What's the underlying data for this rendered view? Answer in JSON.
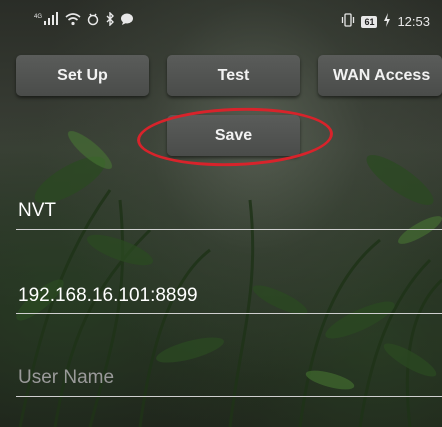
{
  "status_bar": {
    "network_label": "4G",
    "time": "12:53",
    "battery": "61",
    "icons": [
      "signal-icon",
      "wifi-icon",
      "nfc-icon",
      "bluetooth-icon",
      "chat-icon",
      "vibrate-icon",
      "battery-icon",
      "charging-icon"
    ]
  },
  "toolbar": {
    "setup_label": "Set Up",
    "test_label": "Test",
    "wan_label": "WAN Access",
    "save_label": "Save"
  },
  "form": {
    "name_value": "NVT",
    "address_value": "192.168.16.101:8899",
    "username_placeholder": "User Name"
  },
  "colors": {
    "button_bg": "#525452",
    "highlight_ring": "#d8232b",
    "underline": "#cfcfcf"
  }
}
